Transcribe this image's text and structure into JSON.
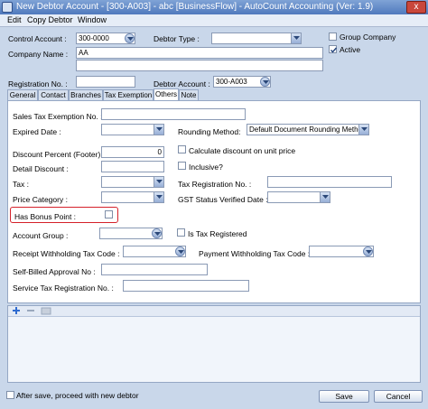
{
  "window": {
    "title": "New Debtor Account - [300-A003] - abc [BusinessFlow] - AutoCount Accounting (Ver: 1.9)",
    "close": "x"
  },
  "menu": [
    "Edit",
    "Copy Debtor",
    "Window"
  ],
  "header": {
    "control_account_label": "Control Account :",
    "control_account_value": "300-0000",
    "debtor_type_label": "Debtor Type :",
    "debtor_type_value": "",
    "group_company_label": "Group Company",
    "group_company_checked": false,
    "active_label": "Active",
    "active_checked": true,
    "company_name_label": "Company Name :",
    "company_name_value": "AA",
    "company_name2_value": "",
    "registration_label": "Registration No. :",
    "registration_value": "",
    "debtor_account_label": "Debtor Account :",
    "debtor_account_value": "300-A003"
  },
  "tabs": [
    "General",
    "Contact",
    "Branches",
    "Tax Exemption",
    "Others",
    "Note"
  ],
  "active_tab": "Others",
  "others": {
    "sales_tax_exemption_label": "Sales Tax Exemption No. :",
    "sales_tax_exemption_value": "",
    "expired_date_label": "Expired Date :",
    "expired_date_value": "",
    "rounding_method_label": "Rounding Method:",
    "rounding_method_value": "Default Document Rounding Method",
    "discount_percent_label": "Discount Percent (Footer):",
    "discount_percent_value": "0",
    "calc_discount_label": "Calculate discount on unit price",
    "calc_discount_checked": false,
    "detail_discount_label": "Detail Discount :",
    "detail_discount_value": "",
    "inclusive_label": "Inclusive?",
    "inclusive_checked": false,
    "tax_label": "Tax :",
    "tax_value": "",
    "tax_registration_label": "Tax Registration No. :",
    "tax_registration_value": "",
    "price_category_label": "Price Category :",
    "price_category_value": "",
    "gst_status_label": "GST Status Verified Date :",
    "gst_status_value": "",
    "bonus_point_label": "Has Bonus Point :",
    "bonus_point_checked": false,
    "account_group_label": "Account Group :",
    "account_group_value": "",
    "is_tax_registered_label": "Is Tax Registered",
    "is_tax_registered_checked": false,
    "receipt_wht_label": "Receipt Withholding Tax Code :",
    "receipt_wht_value": "",
    "payment_wht_label": "Payment Withholding Tax Code :",
    "payment_wht_value": "",
    "self_billed_label": "Self-Billed Approval No :",
    "self_billed_value": "",
    "service_tax_label": "Service Tax Registration No. :",
    "service_tax_value": ""
  },
  "footer": {
    "after_save_label": "After save, proceed with new debtor",
    "after_save_checked": false,
    "save_label": "Save",
    "cancel_label": "Cancel"
  },
  "colors": {
    "highlight": "#d5212a",
    "title_bar": "#4f79bd",
    "window_bg": "#c9d7ea"
  }
}
